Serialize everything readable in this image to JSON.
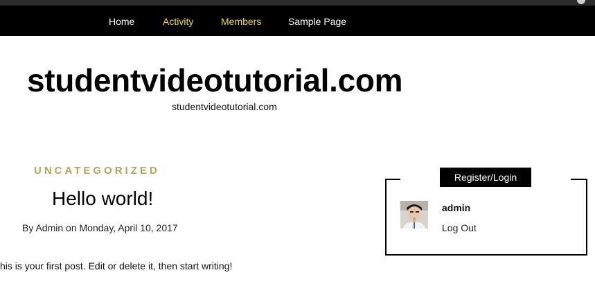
{
  "nav": {
    "items": [
      {
        "label": "Home"
      },
      {
        "label": "Activity"
      },
      {
        "label": "Members"
      },
      {
        "label": "Sample Page"
      }
    ],
    "highlight_color": "#f1dc3a"
  },
  "site": {
    "title": "studentvideotutorial.com",
    "tagline": "studentvideotutorial.com"
  },
  "post": {
    "category": "UNCATEGORIZED",
    "title": "Hello world!",
    "meta": {
      "by": "By",
      "author": "Admin",
      "on": "on",
      "date": "Monday, April 10, 2017"
    },
    "excerpt": "his is your first post. Edit or delete it, then start writing!"
  },
  "widget": {
    "title": "Register/Login",
    "username": "admin",
    "logout_label": "Log Out"
  },
  "colors": {
    "category": "#b9a35a",
    "nav_background": "#000000"
  }
}
